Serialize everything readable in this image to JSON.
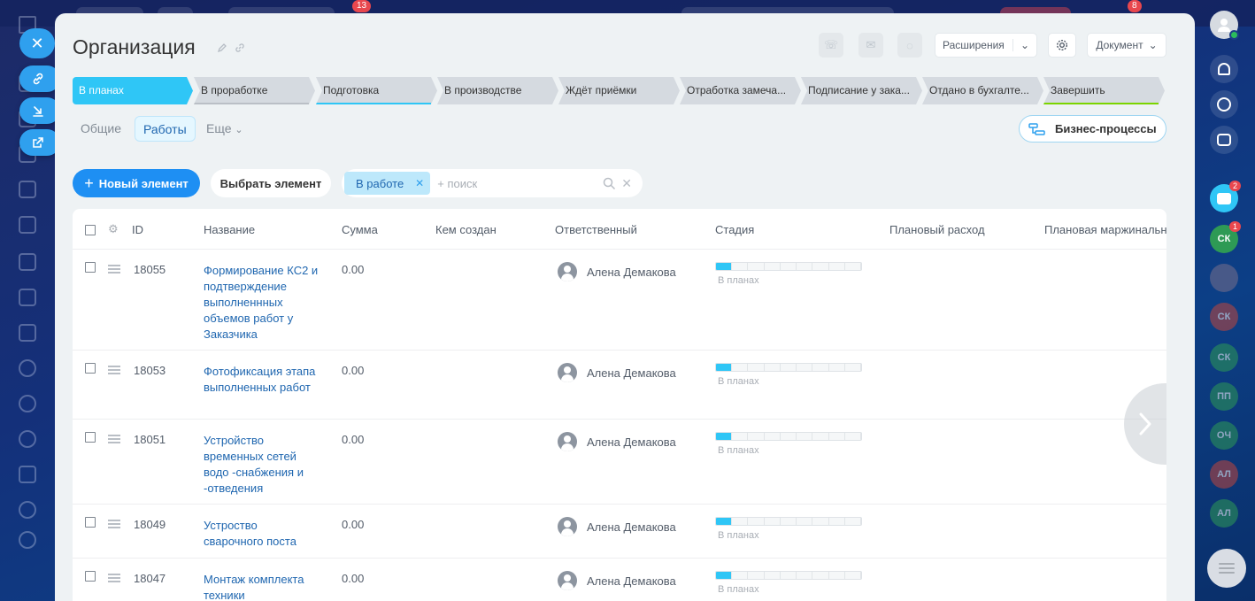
{
  "topbar": {
    "badge_left": "13",
    "badge_right": "8"
  },
  "page": {
    "title": "Организация",
    "header_buttons": {
      "extensions": "Расширения",
      "document": "Документ"
    }
  },
  "stages": [
    {
      "label": "В планах",
      "active": true,
      "underline": ""
    },
    {
      "label": "В проработке",
      "active": false,
      "underline": "#a8adb4"
    },
    {
      "label": "Подготовка",
      "active": false,
      "underline": "#2fc6f6"
    },
    {
      "label": "В производстве",
      "active": false,
      "underline": ""
    },
    {
      "label": "Ждёт приёмки",
      "active": false,
      "underline": ""
    },
    {
      "label": "Отработка замеча...",
      "active": false,
      "underline": ""
    },
    {
      "label": "Подписание у зака...",
      "active": false,
      "underline": ""
    },
    {
      "label": "Отдано в бухгалте...",
      "active": false,
      "underline": ""
    },
    {
      "label": "Завершить",
      "active": false,
      "underline": "#7bd500"
    }
  ],
  "tabs": {
    "general": "Общие",
    "works": "Работы",
    "more": "Еще"
  },
  "bp_button": "Бизнес-процессы",
  "toolbar": {
    "new_element": "Новый элемент",
    "select_element": "Выбрать элемент",
    "filter_chip": "В работе",
    "search_placeholder": "+ поиск"
  },
  "table": {
    "columns": {
      "id": "ID",
      "name": "Название",
      "sum": "Сумма",
      "created_by": "Кем создан",
      "responsible": "Ответственный",
      "stage": "Стадия",
      "planned_expense": "Плановый расход",
      "planned_margin": "Плановая маржинальность"
    },
    "rows": [
      {
        "id": "18055",
        "name": "Формирование КС2 и подтверждение выполненнных объемов работ у Заказчика",
        "sum": "0.00",
        "responsible": "Алена Демакова",
        "stage": "В планах",
        "stage_progress": 1
      },
      {
        "id": "18053",
        "name": "Фотофиксация этапа выполненных работ",
        "sum": "0.00",
        "responsible": "Алена Демакова",
        "stage": "В планах",
        "stage_progress": 1
      },
      {
        "id": "18051",
        "name": "Устройство временных сетей водо -снабжения и -отведения",
        "sum": "0.00",
        "responsible": "Алена Демакова",
        "stage": "В планах",
        "stage_progress": 1
      },
      {
        "id": "18049",
        "name": "Устроство сварочного поста",
        "sum": "0.00",
        "responsible": "Алена Демакова",
        "stage": "В планах",
        "stage_progress": 1
      },
      {
        "id": "18047",
        "name": "Монтаж комплекта техники",
        "sum": "0.00",
        "responsible": "Алена Демакова",
        "stage": "В планах",
        "stage_progress": 1
      }
    ]
  },
  "right_rail": {
    "chat_badge": "2",
    "sk_badge": "1",
    "avatars": [
      "СК",
      "СК",
      "СК",
      "ПП",
      "ОЧ",
      "АЛ",
      "АЛ"
    ]
  },
  "colors": {
    "accent": "#2fc6f6",
    "primary_button": "#1e8ff3",
    "link": "#2067b0"
  }
}
